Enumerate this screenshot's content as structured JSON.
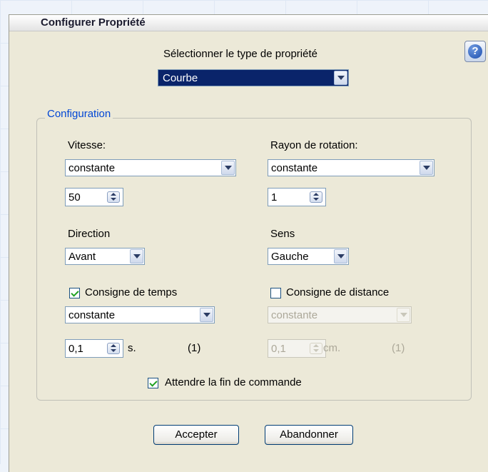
{
  "dialog": {
    "title": "Configurer Propriété",
    "help_icon_glyph": "?"
  },
  "type_select": {
    "label": "Sélectionner le type de propriété",
    "value": "Courbe"
  },
  "group": {
    "title": "Configuration"
  },
  "vitesse": {
    "label": "Vitesse:",
    "mode": "constante",
    "value": "50"
  },
  "rayon": {
    "label": "Rayon de rotation:",
    "mode": "constante",
    "value": "1"
  },
  "direction": {
    "label": "Direction",
    "value": "Avant"
  },
  "sens": {
    "label": "Sens",
    "value": "Gauche"
  },
  "consigne_temps": {
    "label": "Consigne de temps",
    "checked": true,
    "mode": "constante",
    "value": "0,1",
    "unit": "s.",
    "note": "(1)"
  },
  "consigne_distance": {
    "label": "Consigne de distance",
    "checked": false,
    "mode": "constante",
    "value": "0,1",
    "unit": "cm.",
    "note": "(1)"
  },
  "attendre": {
    "label": "Attendre la fin de commande",
    "checked": true
  },
  "buttons": {
    "accept": "Accepter",
    "cancel": "Abandonner"
  },
  "colors": {
    "group_title": "#0046d5",
    "selection": "#0a246a",
    "check": "#21a121"
  }
}
